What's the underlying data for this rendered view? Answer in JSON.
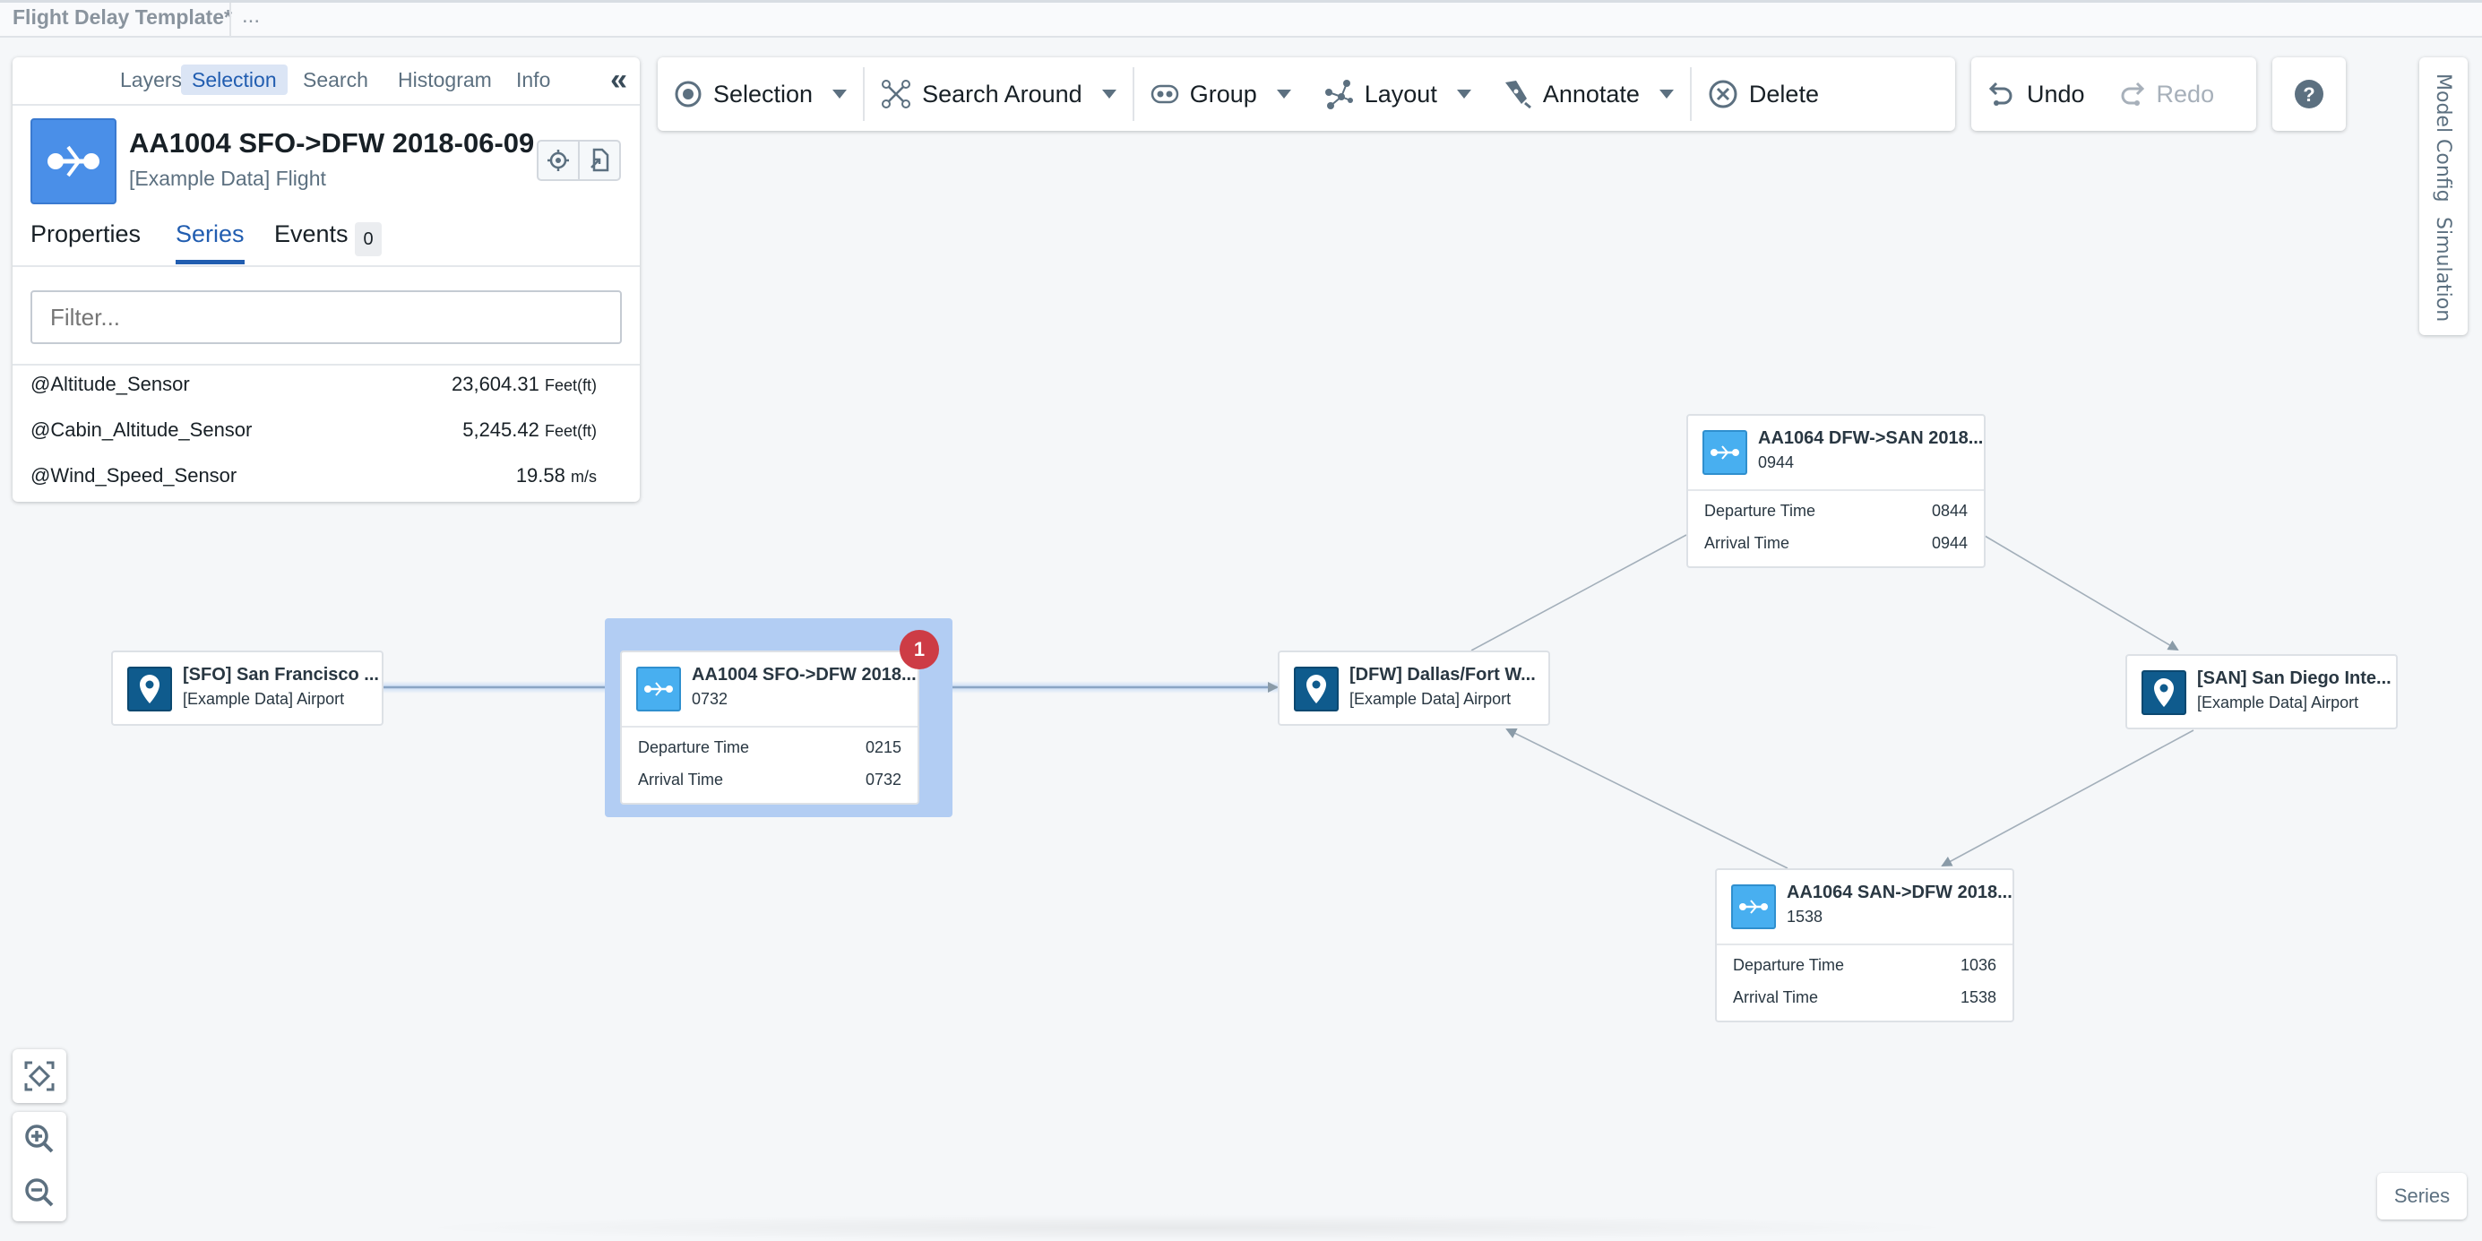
{
  "app": {
    "document_title": "Flight Delay Template*",
    "more_label": "..."
  },
  "left_panel": {
    "tabs": [
      {
        "label": "Layers",
        "active": false
      },
      {
        "label": "Selection",
        "active": true
      },
      {
        "label": "Search",
        "active": false
      },
      {
        "label": "Histogram",
        "active": false
      },
      {
        "label": "Info",
        "active": false
      }
    ],
    "collapse_icon": "double-chevron-left-icon",
    "object": {
      "title": "AA1004 SFO->DFW 2018-06-09",
      "subtitle": "[Example Data] Flight",
      "icon": "flight-icon",
      "actions": [
        "locate-icon",
        "export-icon"
      ]
    },
    "sub_tabs": [
      {
        "label": "Properties",
        "active": false
      },
      {
        "label": "Series",
        "active": true
      },
      {
        "label": "Events",
        "active": false,
        "count": "0"
      }
    ],
    "filter": {
      "placeholder": "Filter...",
      "value": ""
    },
    "series": [
      {
        "name": "@Altitude_Sensor",
        "value": "23,604.31",
        "unit": "Feet(ft)"
      },
      {
        "name": "@Cabin_Altitude_Sensor",
        "value": "5,245.42",
        "unit": "Feet(ft)"
      },
      {
        "name": "@Wind_Speed_Sensor",
        "value": "19.58",
        "unit": "m/s"
      }
    ]
  },
  "toolbar": {
    "selection": "Selection",
    "search_around": "Search Around",
    "group": "Group",
    "layout": "Layout",
    "annotate": "Annotate",
    "delete": "Delete",
    "undo": "Undo",
    "redo": "Redo",
    "help_icon": "help-icon"
  },
  "side_tabs": {
    "model_config": "Model Config",
    "simulation": "Simulation"
  },
  "graph": {
    "selection_count": "1",
    "nodes": [
      {
        "id": "sfo",
        "type": "airport",
        "title": "[SFO] San Francisco ...",
        "subtitle": "[Example Data] Airport"
      },
      {
        "id": "aa1004",
        "type": "flight",
        "title": "AA1004 SFO->DFW 2018...",
        "subtitle": "0732",
        "selected": true,
        "props": [
          {
            "label": "Departure Time",
            "value": "0215"
          },
          {
            "label": "Arrival Time",
            "value": "0732"
          }
        ]
      },
      {
        "id": "dfw",
        "type": "airport",
        "title": "[DFW] Dallas/Fort W...",
        "subtitle": "[Example Data] Airport"
      },
      {
        "id": "aa1064a",
        "type": "flight",
        "title": "AA1064 DFW->SAN 2018...",
        "subtitle": "0944",
        "props": [
          {
            "label": "Departure Time",
            "value": "0844"
          },
          {
            "label": "Arrival Time",
            "value": "0944"
          }
        ]
      },
      {
        "id": "san",
        "type": "airport",
        "title": "[SAN] San Diego Inte...",
        "subtitle": "[Example Data] Airport"
      },
      {
        "id": "aa1064b",
        "type": "flight",
        "title": "AA1064 SAN->DFW 2018...",
        "subtitle": "1538",
        "props": [
          {
            "label": "Departure Time",
            "value": "1036"
          },
          {
            "label": "Arrival Time",
            "value": "1538"
          }
        ]
      }
    ],
    "edges": [
      {
        "from": "sfo",
        "to": "aa1004"
      },
      {
        "from": "aa1004",
        "to": "dfw"
      },
      {
        "from": "dfw",
        "to": "aa1064a"
      },
      {
        "from": "aa1064a",
        "to": "san"
      },
      {
        "from": "san",
        "to": "aa1064b"
      },
      {
        "from": "aa1064b",
        "to": "dfw"
      }
    ]
  },
  "canvas_controls": {
    "fit_icon": "fit-to-screen-icon",
    "zoom_in_icon": "zoom-in-icon",
    "zoom_out_icon": "zoom-out-icon"
  },
  "bottom_right": {
    "series_label": "Series"
  }
}
